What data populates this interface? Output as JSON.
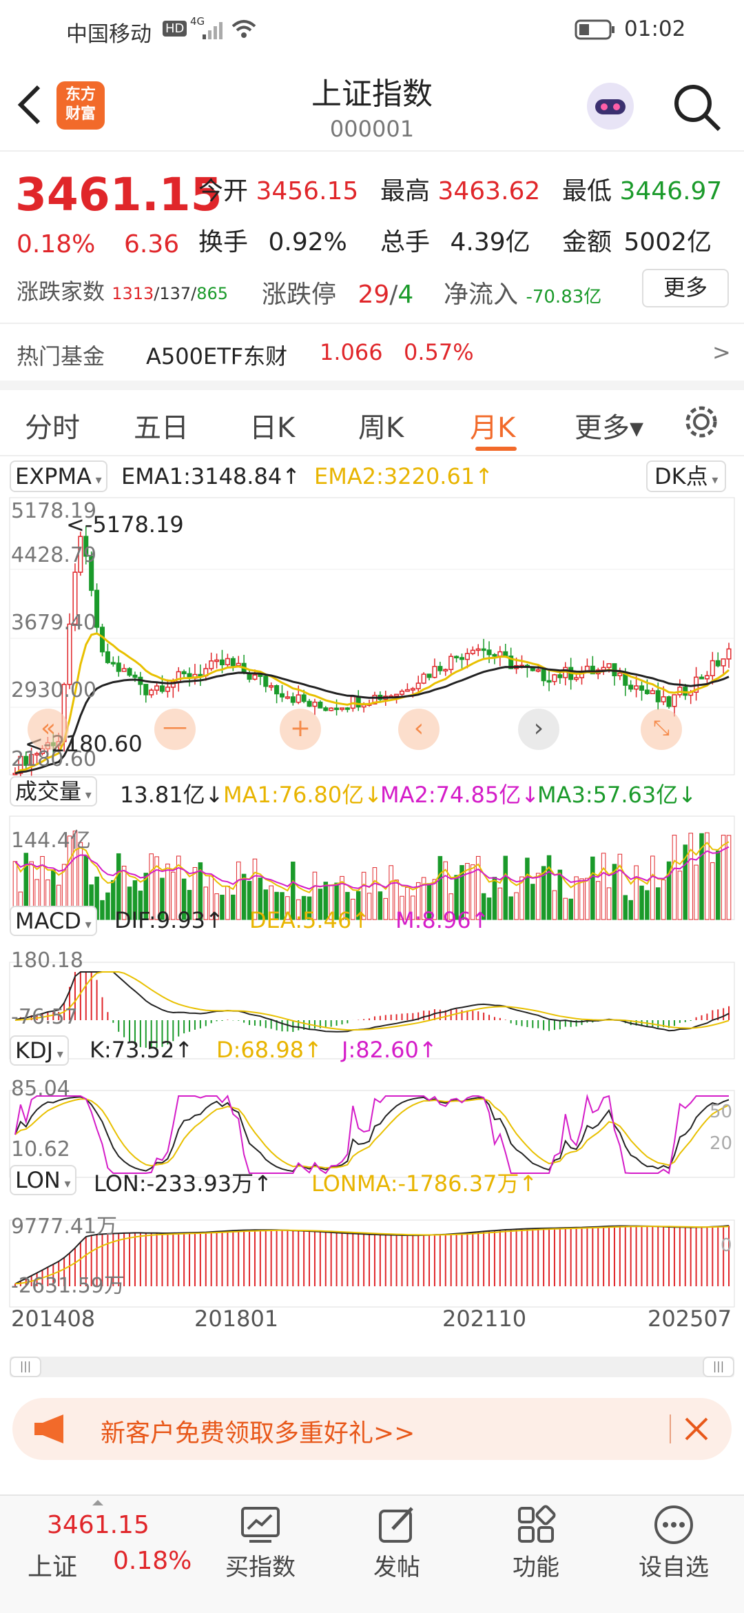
{
  "status": {
    "carrier": "中国移动",
    "hd": "HD",
    "net": "4G",
    "time": "01:02"
  },
  "header": {
    "logo_line1": "东方",
    "logo_line2": "财富",
    "title": "上证指数",
    "code": "000001"
  },
  "quote": {
    "price": "3461.15",
    "pct": "0.18%",
    "chg": "6.36",
    "open_label": "今开",
    "open": "3456.15",
    "high_label": "最高",
    "high": "3463.62",
    "low_label": "最低",
    "low": "3446.97",
    "turn_label": "换手",
    "turn": "0.92%",
    "vol_label": "总手",
    "vol": "4.39亿",
    "amt_label": "金额",
    "amt": "5002亿",
    "adv_label": "涨跌家数",
    "adv_up": "1313",
    "adv_flat": "/137/",
    "adv_down": "865",
    "limit_label": "涨跌停",
    "limit_up": "29",
    "limit_sep": "/",
    "limit_down": "4",
    "flow_label": "净流入",
    "flow": "-70.83亿",
    "more": "更多",
    "fund_label": "热门基金",
    "fund_name": "A500ETF东财",
    "fund_price": "1.066",
    "fund_pct": "0.57%",
    "fund_arrow": ">"
  },
  "tabs": [
    "分时",
    "五日",
    "日K",
    "周K",
    "月K",
    "更多▾"
  ],
  "active_tab": 4,
  "ind": {
    "expma": {
      "name": "EXPMA",
      "ema1": "EMA1:3148.84↑",
      "ema2": "EMA2:3220.61↑",
      "dk": "DK点"
    },
    "price_axis": {
      "hi": "5178.19",
      "t1": "4428.79",
      "t2": "3679.40",
      "t3": "2930.00",
      "lo": "2180.60",
      "hi_marker": "<-5178.19",
      "lo_marker": "<-2180.60"
    },
    "vol": {
      "name": "成交量",
      "val": "13.81亿↓",
      "ma1": "MA1:76.80亿↓",
      "ma2": "MA2:74.85亿↓",
      "ma3": "MA3:57.63亿↓",
      "axis": "144.4亿"
    },
    "macd": {
      "name": "MACD",
      "dif": "DIF:9.93↑",
      "dea": "DEA:5.46↑",
      "m": "M:8.96↑",
      "hi": "180.18",
      "lo": "-76.57"
    },
    "kdj": {
      "name": "KDJ",
      "k": "K:73.52↑",
      "d": "D:68.98↑",
      "j": "J:82.60↑",
      "hi": "85.04",
      "lo": "10.62",
      "r50": "50",
      "r20": "20"
    },
    "lon": {
      "name": "LON",
      "lon": "LON:-233.93万↑",
      "lonma": "LONMA:-1786.37万↑",
      "hi": "9777.41万",
      "lo": "-2631.59万",
      "zero": "0"
    },
    "dates": [
      "201408",
      "201801",
      "202110",
      "202507"
    ]
  },
  "promo": {
    "text": "新客户免费领取多重好礼>>"
  },
  "bottom": {
    "price": "3461.15",
    "name": "上证",
    "pct": "0.18%",
    "items": [
      "买指数",
      "发帖",
      "功能",
      "设自选"
    ]
  },
  "chart_data": {
    "type": "candlestick",
    "note_series": [
      "EMA1",
      "EMA2"
    ],
    "range": [
      2180.6,
      5178.19
    ],
    "x_labels": [
      "201408",
      "201801",
      "202110",
      "202507"
    ],
    "last": 3461.15,
    "ema1": 3148.84,
    "ema2": 3220.61
  }
}
